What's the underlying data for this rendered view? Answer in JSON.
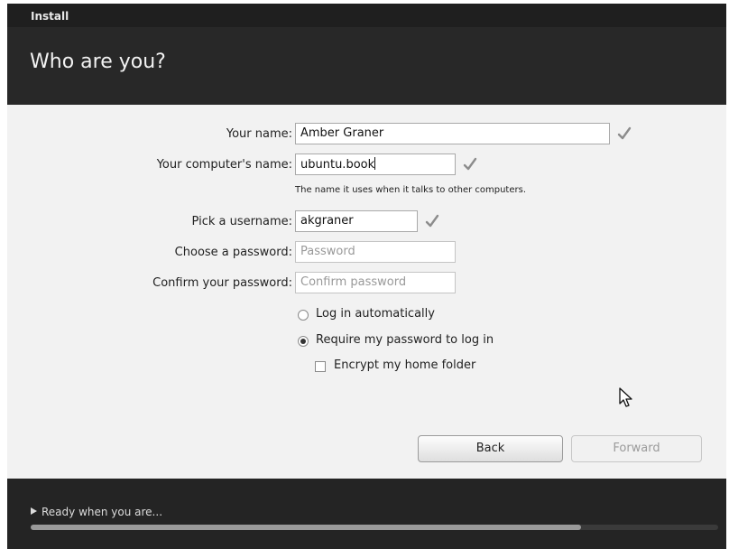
{
  "window": {
    "title": "Install"
  },
  "header": {
    "title": "Who are you?"
  },
  "form": {
    "name": {
      "label": "Your name:",
      "value": "Amber Graner",
      "valid": true
    },
    "computer": {
      "label": "Your computer's name:",
      "value": "ubuntu.book",
      "valid": true,
      "hint": "The name it uses when it talks to other computers."
    },
    "username": {
      "label": "Pick a username:",
      "value": "akgraner",
      "valid": true
    },
    "password": {
      "label": "Choose a password:",
      "placeholder": "Password"
    },
    "confirm": {
      "label": "Confirm your password:",
      "placeholder": "Confirm password"
    },
    "login_auto": {
      "label": "Log in automatically",
      "selected": false
    },
    "login_password": {
      "label": "Require my password to log in",
      "selected": true
    },
    "encrypt_home": {
      "label": "Encrypt my home folder",
      "checked": false
    }
  },
  "buttons": {
    "back": "Back",
    "forward": "Forward"
  },
  "footer": {
    "status": "Ready when you are...",
    "progress": 0.8
  },
  "colors": {
    "header_bg": "#282828",
    "content_bg": "#f2f2f2",
    "footer_bg": "#242424"
  },
  "icons": [
    "checkmark-icon",
    "expander-arrow-icon",
    "mouse-pointer-icon"
  ]
}
